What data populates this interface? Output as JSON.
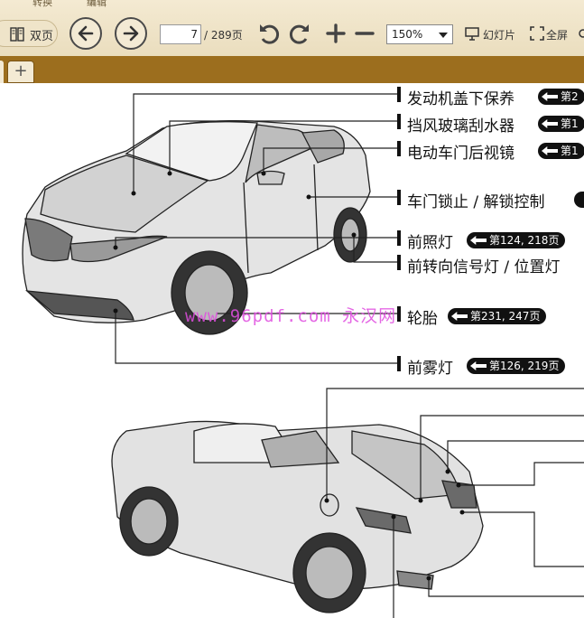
{
  "toolbar": {
    "top_tab_1": "转换",
    "top_tab_2": "编辑",
    "double_page_label": "双页",
    "current_page": "7",
    "total_pages": "/ 289页",
    "zoom_value": "150%",
    "slideshow_label": "幻灯片",
    "fullscreen_label": "全屏"
  },
  "tabbar": {
    "add_label": "+"
  },
  "watermark": "www.96pdf.com 永汉网",
  "callouts": [
    {
      "label": "发动机盖下保养",
      "ref": "第2"
    },
    {
      "label": "挡风玻璃刮水器",
      "ref": "第1"
    },
    {
      "label": "电动车门后视镜",
      "ref": "第1"
    },
    {
      "label": "车门锁止 / 解锁控制",
      "ref": ""
    },
    {
      "label": "前照灯",
      "ref": "第124, 218页"
    },
    {
      "label": "前转向信号灯 / 位置灯",
      "ref": ""
    },
    {
      "label": "轮胎",
      "ref": "第231, 247页"
    },
    {
      "label": "前雾灯",
      "ref": "第126, 219页"
    }
  ]
}
